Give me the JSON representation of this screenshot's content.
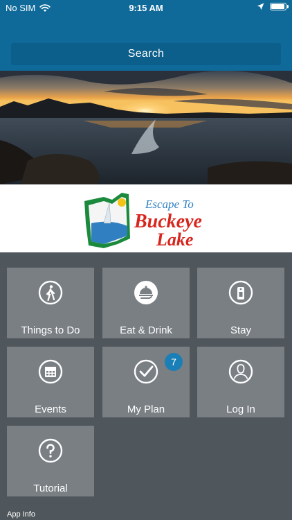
{
  "status_bar": {
    "carrier": "No SIM",
    "time": "9:15 AM",
    "battery_level": 0.85
  },
  "search": {
    "label": "Search"
  },
  "logo": {
    "line1": "Escape To",
    "line2": "Buckeye",
    "line3": "Lake"
  },
  "tiles": [
    {
      "label": "Things to Do",
      "icon": "walking-person-icon"
    },
    {
      "label": "Eat & Drink",
      "icon": "food-platter-icon"
    },
    {
      "label": "Stay",
      "icon": "hotel-tag-icon"
    },
    {
      "label": "Events",
      "icon": "calendar-icon"
    },
    {
      "label": "My Plan",
      "icon": "checkmark-icon",
      "badge": "7"
    },
    {
      "label": "Log In",
      "icon": "user-icon"
    },
    {
      "label": "Tutorial",
      "icon": "question-icon"
    }
  ],
  "footer": {
    "app_info": "App Info"
  },
  "colors": {
    "header": "#0f6a9a",
    "tile": "#7a7f84",
    "background": "#50575c",
    "badge": "#1a7fb6"
  }
}
